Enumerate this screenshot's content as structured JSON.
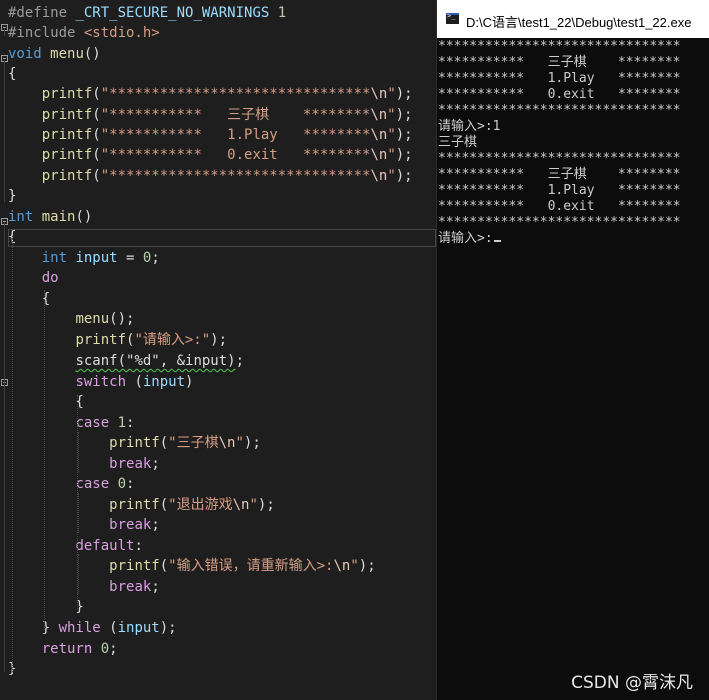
{
  "editor": {
    "lines": [
      [
        [
          "pp",
          "#define "
        ],
        [
          "id",
          "_CRT_SECURE_NO_WARNINGS"
        ],
        [
          "plain",
          " "
        ],
        [
          "num",
          "1"
        ]
      ],
      [
        [
          "pp",
          "#include "
        ],
        [
          "str",
          "<stdio.h>"
        ]
      ],
      [
        [
          "kw",
          "void"
        ],
        [
          "plain",
          " "
        ],
        [
          "fn",
          "menu"
        ],
        [
          "plain",
          "()"
        ]
      ],
      [
        [
          "plain",
          "{"
        ]
      ],
      [
        [
          "plain",
          "    "
        ],
        [
          "fn",
          "printf"
        ],
        [
          "plain",
          "("
        ],
        [
          "str",
          "\"*******************************"
        ],
        [
          "esc",
          "\\n"
        ],
        [
          "str",
          "\""
        ],
        [
          "plain",
          ");"
        ]
      ],
      [
        [
          "plain",
          "    "
        ],
        [
          "fn",
          "printf"
        ],
        [
          "plain",
          "("
        ],
        [
          "str",
          "\"***********   三子棋    ********"
        ],
        [
          "esc",
          "\\n"
        ],
        [
          "str",
          "\""
        ],
        [
          "plain",
          ");"
        ]
      ],
      [
        [
          "plain",
          "    "
        ],
        [
          "fn",
          "printf"
        ],
        [
          "plain",
          "("
        ],
        [
          "str",
          "\"***********   1.Play   ********"
        ],
        [
          "esc",
          "\\n"
        ],
        [
          "str",
          "\""
        ],
        [
          "plain",
          ");"
        ]
      ],
      [
        [
          "plain",
          "    "
        ],
        [
          "fn",
          "printf"
        ],
        [
          "plain",
          "("
        ],
        [
          "str",
          "\"***********   0.exit   ********"
        ],
        [
          "esc",
          "\\n"
        ],
        [
          "str",
          "\""
        ],
        [
          "plain",
          ");"
        ]
      ],
      [
        [
          "plain",
          "    "
        ],
        [
          "fn",
          "printf"
        ],
        [
          "plain",
          "("
        ],
        [
          "str",
          "\"*******************************"
        ],
        [
          "esc",
          "\\n"
        ],
        [
          "str",
          "\""
        ],
        [
          "plain",
          ");"
        ]
      ],
      [
        [
          "plain",
          "}"
        ]
      ],
      [
        [
          "kw",
          "int"
        ],
        [
          "plain",
          " "
        ],
        [
          "fn",
          "main"
        ],
        [
          "plain",
          "()"
        ]
      ],
      [
        [
          "plain",
          "{"
        ]
      ],
      [
        [
          "plain",
          "    "
        ],
        [
          "kw",
          "int"
        ],
        [
          "plain",
          " "
        ],
        [
          "id",
          "input"
        ],
        [
          "plain",
          " = "
        ],
        [
          "num",
          "0"
        ],
        [
          "plain",
          ";"
        ]
      ],
      [
        [
          "plain",
          "    "
        ],
        [
          "kw2",
          "do"
        ]
      ],
      [
        [
          "plain",
          "    {"
        ]
      ],
      [
        [
          "plain",
          "        "
        ],
        [
          "fn",
          "menu"
        ],
        [
          "plain",
          "();"
        ]
      ],
      [
        [
          "plain",
          "        "
        ],
        [
          "fn",
          "printf"
        ],
        [
          "plain",
          "("
        ],
        [
          "str",
          "\"请输入>:\""
        ],
        [
          "plain",
          ");"
        ]
      ],
      [
        [
          "plain",
          "        "
        ],
        [
          "sq",
          "scanf(\"%d\", &input)"
        ],
        [
          "plain",
          ";"
        ]
      ],
      [
        [
          "plain",
          "        "
        ],
        [
          "kw2",
          "switch"
        ],
        [
          "plain",
          " ("
        ],
        [
          "id",
          "input"
        ],
        [
          "plain",
          ")"
        ]
      ],
      [
        [
          "plain",
          "        {"
        ]
      ],
      [
        [
          "plain",
          "        "
        ],
        [
          "kw2",
          "case"
        ],
        [
          "plain",
          " "
        ],
        [
          "num",
          "1"
        ],
        [
          "plain",
          ":"
        ]
      ],
      [
        [
          "plain",
          "            "
        ],
        [
          "fn",
          "printf"
        ],
        [
          "plain",
          "("
        ],
        [
          "str",
          "\"三子棋"
        ],
        [
          "esc",
          "\\n"
        ],
        [
          "str",
          "\""
        ],
        [
          "plain",
          ");"
        ]
      ],
      [
        [
          "plain",
          "            "
        ],
        [
          "kw2",
          "break"
        ],
        [
          "plain",
          ";"
        ]
      ],
      [
        [
          "plain",
          "        "
        ],
        [
          "kw2",
          "case"
        ],
        [
          "plain",
          " "
        ],
        [
          "num",
          "0"
        ],
        [
          "plain",
          ":"
        ]
      ],
      [
        [
          "plain",
          "            "
        ],
        [
          "fn",
          "printf"
        ],
        [
          "plain",
          "("
        ],
        [
          "str",
          "\"退出游戏"
        ],
        [
          "esc",
          "\\n"
        ],
        [
          "str",
          "\""
        ],
        [
          "plain",
          ");"
        ]
      ],
      [
        [
          "plain",
          "            "
        ],
        [
          "kw2",
          "break"
        ],
        [
          "plain",
          ";"
        ]
      ],
      [
        [
          "plain",
          "        "
        ],
        [
          "kw2",
          "default"
        ],
        [
          "plain",
          ":"
        ]
      ],
      [
        [
          "plain",
          "            "
        ],
        [
          "fn",
          "printf"
        ],
        [
          "plain",
          "("
        ],
        [
          "str",
          "\"输入错误，请重新输入>:"
        ],
        [
          "esc",
          "\\n"
        ],
        [
          "str",
          "\""
        ],
        [
          "plain",
          ");"
        ]
      ],
      [
        [
          "plain",
          "            "
        ],
        [
          "kw2",
          "break"
        ],
        [
          "plain",
          ";"
        ]
      ],
      [
        [
          "plain",
          "        }"
        ]
      ],
      [
        [
          "plain",
          "    } "
        ],
        [
          "kw2",
          "while"
        ],
        [
          "plain",
          " ("
        ],
        [
          "id",
          "input"
        ],
        [
          "plain",
          ");"
        ]
      ],
      [
        [
          "plain",
          "    "
        ],
        [
          "kw2",
          "return"
        ],
        [
          "plain",
          " "
        ],
        [
          "num",
          "0"
        ],
        [
          "plain",
          ";"
        ]
      ],
      [
        [
          "plain",
          "}"
        ]
      ]
    ]
  },
  "console": {
    "title": "D:\\C语言\\test1_22\\Debug\\test1_22.exe",
    "lines": [
      "*******************************",
      "***********   三子棋    ********",
      "***********   1.Play   ********",
      "***********   0.exit   ********",
      "*******************************",
      "请输入>:1",
      "三子棋",
      "*******************************",
      "***********   三子棋    ********",
      "***********   1.Play   ********",
      "***********   0.exit   ********",
      "*******************************",
      "请输入>:"
    ]
  },
  "watermark": "CSDN @霄沫凡"
}
